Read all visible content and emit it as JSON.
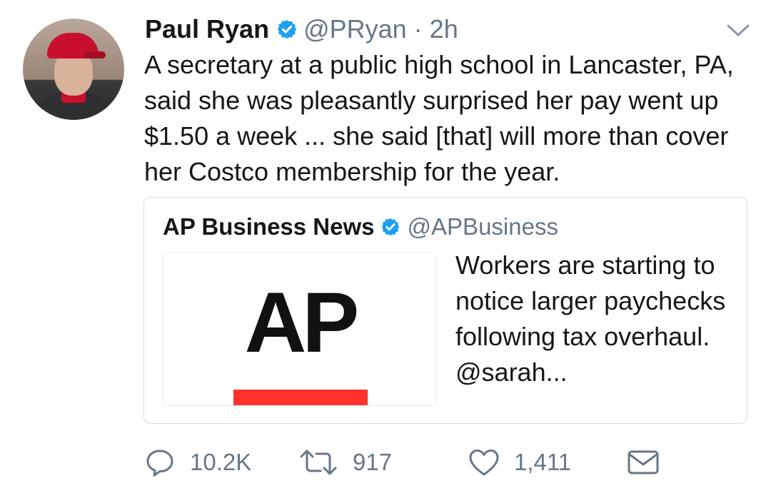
{
  "tweet": {
    "author_name": "Paul Ryan",
    "author_handle": "@PRyan",
    "separator": "·",
    "time": "2h",
    "text": "A secretary at a public high school in Lancaster, PA, said she was pleasantly surprised her pay went up $1.50 a week ... she said [that] will more than cover her Costco membership for the year."
  },
  "quoted_tweet": {
    "author_name": "AP Business News",
    "author_handle": "@APBusiness",
    "logo_text": "AP",
    "text": "Workers are starting to notice larger paychecks following tax overhaul. @sarah..."
  },
  "actions": {
    "reply_count": "10.2K",
    "retweet_count": "917",
    "like_count": "1,411"
  },
  "colors": {
    "verified_blue": "#1da1f2",
    "secondary_text": "#657786",
    "ap_red": "#ff322e"
  },
  "icons": [
    "verified-badge-icon",
    "chevron-down-icon",
    "reply-icon",
    "retweet-icon",
    "heart-icon",
    "envelope-icon"
  ]
}
